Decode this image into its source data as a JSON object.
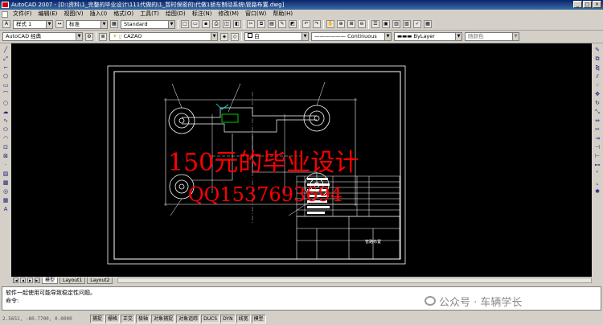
{
  "window": {
    "title": "AutoCAD 2007 - [D:\\资料\\1_完整的毕业设计\\111代做的\\1_暂时保密的\\代做1轿车制动系统\\管路布置.dwg]"
  },
  "menu": [
    "文件(F)",
    "编辑(E)",
    "视图(V)",
    "插入(I)",
    "格式(O)",
    "工具(T)",
    "绘图(D)",
    "标注(N)",
    "修改(M)",
    "窗口(W)",
    "帮助(H)"
  ],
  "toolbar1": {
    "text_style": "样式 1",
    "dim_style": "标准",
    "table_style": "Standard"
  },
  "toolbar2": {
    "workspace": "AutoCAD 经典",
    "layer": "CAZAO",
    "color": "白",
    "linetype": "Continuous",
    "lineweight": "ByLayer",
    "plotstyle": "随颜色"
  },
  "overlay": {
    "line1": "150元的毕业设计",
    "line2": "QQ1537693694"
  },
  "title_block": {
    "name": "管路布置"
  },
  "tabs": {
    "model": "模型",
    "layout1": "Layout1",
    "layout2": "Layout2"
  },
  "command": {
    "line1": "软件一起使用可能导致稳定性问题。",
    "prompt": "命令:"
  },
  "status": {
    "coords": "2.5651, -80.7700, 0.0000",
    "buttons": [
      "捕捉",
      "栅格",
      "正交",
      "极轴",
      "对象捕捉",
      "对象追踪",
      "DUCS",
      "DYN",
      "线宽",
      "模型"
    ]
  },
  "watermark": "公众号 · 车辆学长",
  "colors": {
    "canvas": "#000000",
    "overlay_text": "#ff0000",
    "drawing_lines": "#ffffff",
    "title_bar": "#0a246a"
  }
}
